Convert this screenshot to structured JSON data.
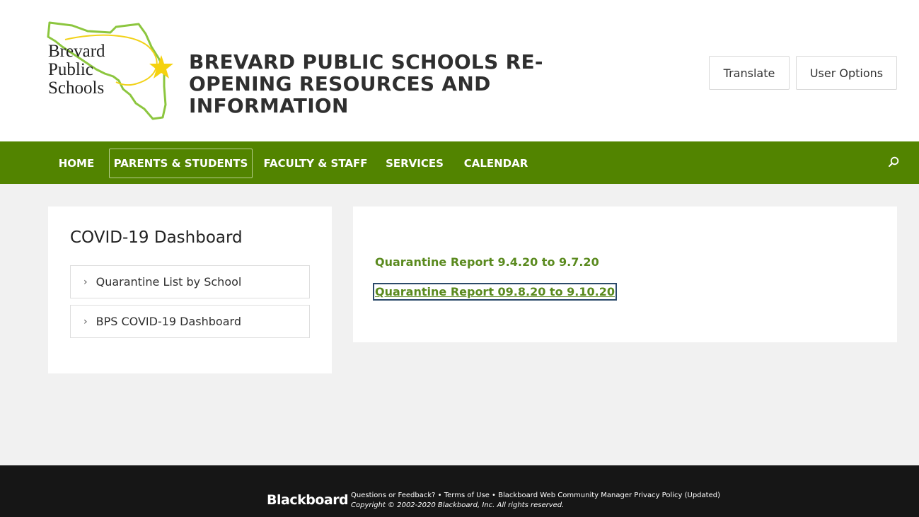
{
  "header": {
    "logo_lines": [
      "Brevard",
      "Public",
      "Schools"
    ],
    "title": "BREVARD PUBLIC SCHOOLS RE-OPENING RESOURCES AND INFORMATION",
    "translate_label": "Translate",
    "user_options_label": "User Options"
  },
  "nav": {
    "items": [
      {
        "label": "HOME"
      },
      {
        "label": "PARENTS & STUDENTS"
      },
      {
        "label": "FACULTY & STAFF"
      },
      {
        "label": "SERVICES"
      },
      {
        "label": "CALENDAR"
      }
    ],
    "active": "PARENTS & STUDENTS",
    "search_icon": "search-icon"
  },
  "sidebar": {
    "title": "COVID-19 Dashboard",
    "links": [
      {
        "label": "Quarantine List by School"
      },
      {
        "label": "BPS COVID-19 Dashboard"
      }
    ]
  },
  "content": {
    "links": [
      {
        "label": "Quarantine Report 9.4.20 to 9.7.20"
      },
      {
        "label": "Quarantine Report 09.8.20 to 9.10.20"
      }
    ]
  },
  "footer": {
    "brand": "Blackboard",
    "links": [
      "Questions or Feedback?",
      "Terms of Use",
      "Blackboard Web Community Manager Privacy Policy (Updated)"
    ],
    "separator": " • ",
    "copyright": "Copyright © 2002-2020 Blackboard, Inc. All rights reserved."
  },
  "colors": {
    "nav_green": "#528400",
    "link_green": "#5a8a1e",
    "footer_bg": "#161616",
    "page_bg": "#f1f1f1"
  }
}
